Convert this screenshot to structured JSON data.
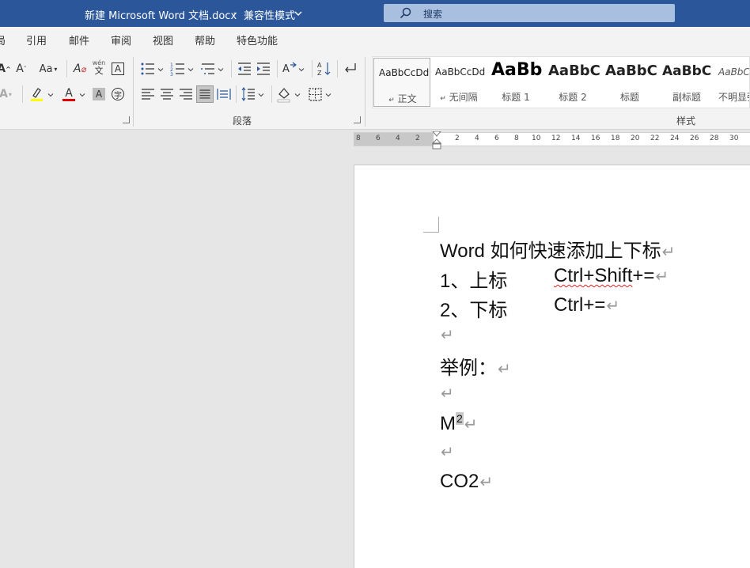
{
  "titlebar": {
    "doc_title": "新建 Microsoft Word 文档.docx",
    "separator": "-",
    "mode": "兼容性模式",
    "search_label": "搜索"
  },
  "menu": {
    "tabs": [
      "局",
      "引用",
      "邮件",
      "审阅",
      "视图",
      "帮助",
      "特色功能"
    ]
  },
  "ribbon": {
    "font_row1": {
      "aa": "Aa",
      "wen_top": "wén",
      "wen_bottom": "文",
      "boxed_a": "A"
    },
    "paragraph_label": "段落",
    "styles_label": "样式",
    "styles": [
      {
        "preview": "AaBbCcDd",
        "name": "正文",
        "prefix": "↵"
      },
      {
        "preview": "AaBbCcDd",
        "name": "无间隔",
        "prefix": "↵"
      },
      {
        "preview": "AaBb",
        "name": "标题 1",
        "prefix": ""
      },
      {
        "preview": "AaBbC",
        "name": "标题 2",
        "prefix": ""
      },
      {
        "preview": "AaBbC",
        "name": "标题",
        "prefix": ""
      },
      {
        "preview": "AaBbC",
        "name": "副标题",
        "prefix": ""
      },
      {
        "preview": "AaBbCc",
        "name": "不明显强调",
        "prefix": ""
      }
    ],
    "colors": {
      "highlight": "#ffff00",
      "font_color": "#e00000"
    }
  },
  "ruler": {
    "left_ticks": [
      "8",
      "6",
      "4",
      "2"
    ],
    "right_ticks": [
      "2",
      "4",
      "6",
      "8",
      "10",
      "12",
      "14",
      "16",
      "18",
      "20",
      "22",
      "24",
      "26",
      "28",
      "30"
    ]
  },
  "document": {
    "line1": "Word 如何快速添加上下标",
    "line2_label": "1、上标",
    "line2_shortcut_a": "Ctrl+Shift",
    "line2_shortcut_b": "+=",
    "line3_label": "2、下标",
    "line3_shortcut": "Ctrl+=",
    "line5": "举例：",
    "line7_base": "M",
    "line7_sup": "2",
    "line9": "CO2",
    "pilcrow": "↵"
  }
}
